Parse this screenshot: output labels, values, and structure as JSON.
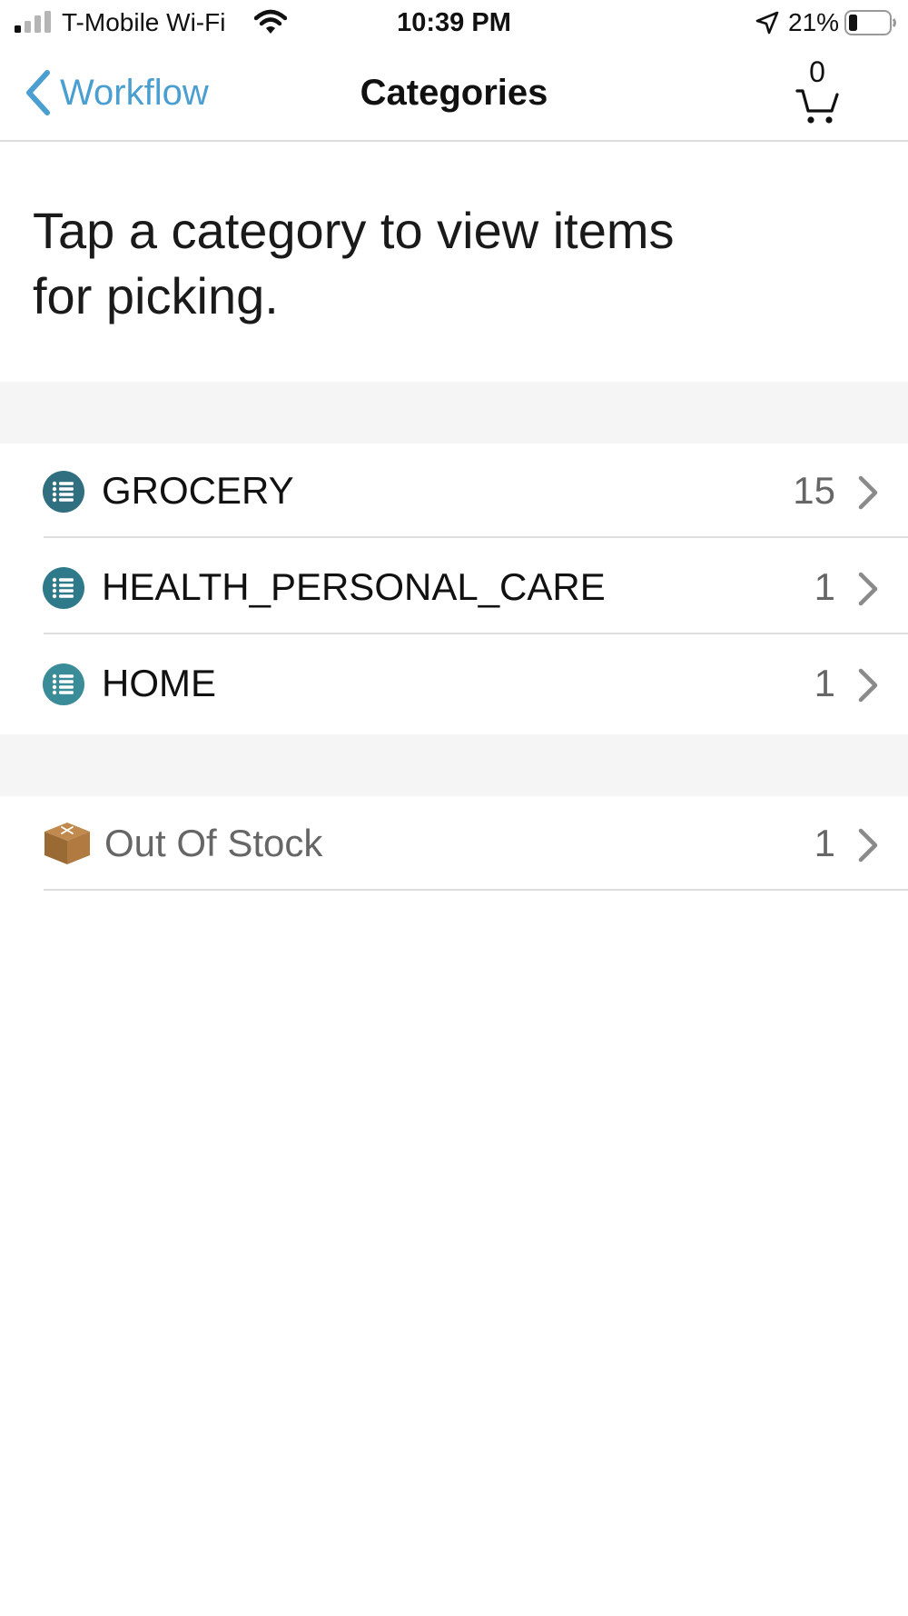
{
  "status_bar": {
    "carrier": "T-Mobile Wi-Fi",
    "time": "10:39 PM",
    "battery_percent": "21%",
    "icons": [
      "signal-icon",
      "wifi-icon",
      "location-arrow-icon",
      "battery-icon"
    ]
  },
  "nav": {
    "back_label": "Workflow",
    "title": "Categories",
    "cart_count": "0",
    "tint_color": "#4a9fd0"
  },
  "instructions": "Tap a category to view items for picking.",
  "categories": [
    {
      "label": "GROCERY",
      "count": "15",
      "icon": "list-icon"
    },
    {
      "label": "HEALTH_PERSONAL_CARE",
      "count": "1",
      "icon": "list-icon"
    },
    {
      "label": "HOME",
      "count": "1",
      "icon": "list-icon"
    }
  ],
  "out_of_stock": {
    "label": "Out Of Stock",
    "count": "1",
    "icon": "box-icon"
  },
  "colors": {
    "list_icon": "#2f7a8a",
    "box_icon": "#a0733f",
    "muted_text": "#666666",
    "section_background": "#f5f5f5"
  }
}
